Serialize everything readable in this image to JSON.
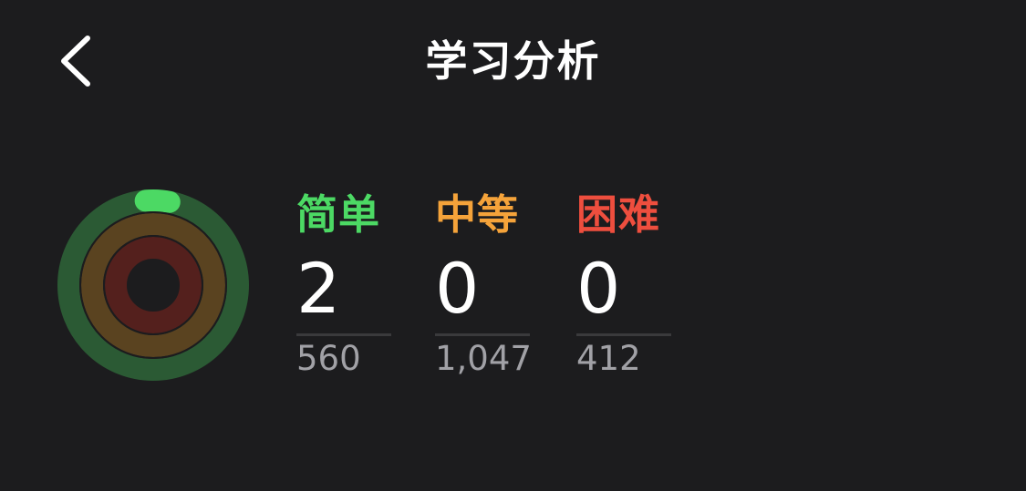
{
  "header": {
    "title": "学习分析",
    "back_icon": "chevron-left-icon"
  },
  "colors": {
    "background": "#1c1c1e",
    "easy": "#4cd964",
    "medium": "#f5a33a",
    "hard": "#ee4e3e",
    "secondary_text": "#a1a1a6"
  },
  "rings": {
    "easy_progress": 0.0036,
    "medium_progress": 0,
    "hard_progress": 0
  },
  "stats": [
    {
      "label": "简单",
      "value": "2",
      "total": "560"
    },
    {
      "label": "中等",
      "value": "0",
      "total": "1,047"
    },
    {
      "label": "困难",
      "value": "0",
      "total": "412"
    }
  ]
}
